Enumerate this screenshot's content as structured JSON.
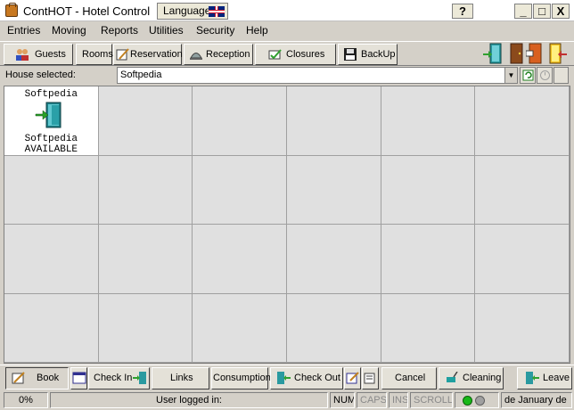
{
  "window": {
    "title": "ContHOT - Hotel Control",
    "language_label": "Language",
    "help_btn": "?",
    "min_btn": "_",
    "max_btn": "□",
    "close_btn": "X"
  },
  "menu": [
    "Entries",
    "Moving",
    "Reports",
    "Utilities",
    "Security",
    "Help"
  ],
  "toolbar": {
    "guests": "Guests",
    "rooms": "Rooms",
    "reservation": "Reservation",
    "reception": "Reception",
    "closures": "Closures",
    "backup": "BackUp"
  },
  "house": {
    "label": "House selected:",
    "value": "Softpedia"
  },
  "rooms": [
    {
      "name": "Softpedia",
      "owner": "Softpedia",
      "status": "AVAILABLE"
    }
  ],
  "bottom": {
    "book": "Book",
    "checkin": "Check In",
    "links": "Links",
    "consumption": "Consumption",
    "checkout": "Check Out",
    "cancel": "Cancel",
    "cleaning": "Cleaning",
    "leave": "Leave"
  },
  "status": {
    "progress": "0%",
    "user": "User logged in:",
    "num": "NUM",
    "caps": "CAPS",
    "ins": "INS",
    "scroll": "SCROLL",
    "date": "de January de"
  },
  "colors": {
    "led_green": "#18b818",
    "led_gray": "#a0a0a0",
    "door_teal": "#2a9aa0"
  }
}
